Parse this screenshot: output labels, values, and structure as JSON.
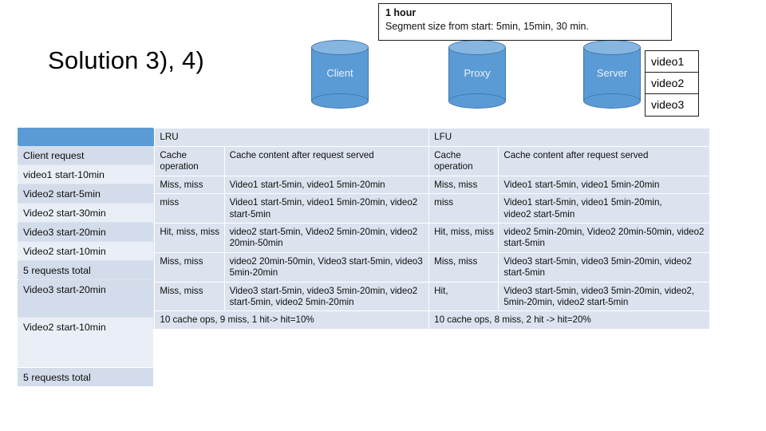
{
  "slide": {
    "title": "Solution 3), 4)",
    "note": {
      "line1": "1 hour",
      "line2": "Segment size from start: 5min, 15min, 30 min."
    },
    "nodes": [
      {
        "name": "Client"
      },
      {
        "name": "Proxy"
      },
      {
        "name": "Server"
      }
    ],
    "videos": [
      "video1",
      "video2",
      "video3"
    ],
    "colors": {
      "header_blue": "#5b9bd5",
      "row_dark": "#d3dcea",
      "row_light": "#eaeff7",
      "cylinder_body": "#5b9bd5",
      "cylinder_top": "#86b6e0"
    }
  },
  "table": {
    "group_headers": {
      "blank": "",
      "lru": "LRU",
      "lfu": "LFU"
    },
    "left_column": {
      "rows": [
        "Client request",
        "video1 start-10min",
        "Video2 start-5min",
        "Video2 start-30min",
        "Video3 start-20min",
        "Video2 start-10min",
        "5 requests total",
        "Video3 start-20min",
        "Video2 start-10min",
        "5 requests total"
      ]
    },
    "subheaders": {
      "lru_op": "Cache operation",
      "lru_content": "Cache content after request served",
      "lfu_op": "Cache operation",
      "lfu_content": "Cache content after request served"
    },
    "rows": [
      {
        "lru_op": "Miss, miss",
        "lru_content": "Video1 start-5min, video1 5min-20min",
        "lfu_op": "Miss, miss",
        "lfu_content": "Video1 start-5min, video1 5min-20min"
      },
      {
        "lru_op": "miss",
        "lru_content": "Video1 start-5min, video1 5min-20min, video2 start-5min",
        "lfu_op": "miss",
        "lfu_content": "Video1 start-5min, video1 5min-20min,\nvideo2 start-5min"
      },
      {
        "lru_op": "Hit, miss, miss",
        "lru_content": "video2 start-5min, Video2 5min-20min, video2 20min-50min",
        "lfu_op": "Hit, miss, miss",
        "lfu_content": "video2 5min-20min, Video2 20min-50min, video2 start-5min"
      },
      {
        "lru_op": "Miss, miss",
        "lru_content": "video2 20min-50min, Video3 start-5min, video3 5min-20min",
        "lfu_op": "Miss, miss",
        "lfu_content": "Video3 start-5min, video3 5min-20min, video2 start-5min"
      },
      {
        "lru_op": "Miss, miss",
        "lru_content": "Video3 start-5min, video3 5min-20min, video2 start-5min, video2 5min-20min",
        "lfu_op": "Hit,",
        "lfu_content": "Video3 start-5min, video3 5min-20min, video2, 5min-20min, video2 start-5min"
      }
    ],
    "totals": {
      "lru": "10 cache ops, 9 miss, 1 hit-> hit=10%",
      "lfu": "10 cache ops, 8 miss, 2 hit -> hit=20%"
    }
  }
}
